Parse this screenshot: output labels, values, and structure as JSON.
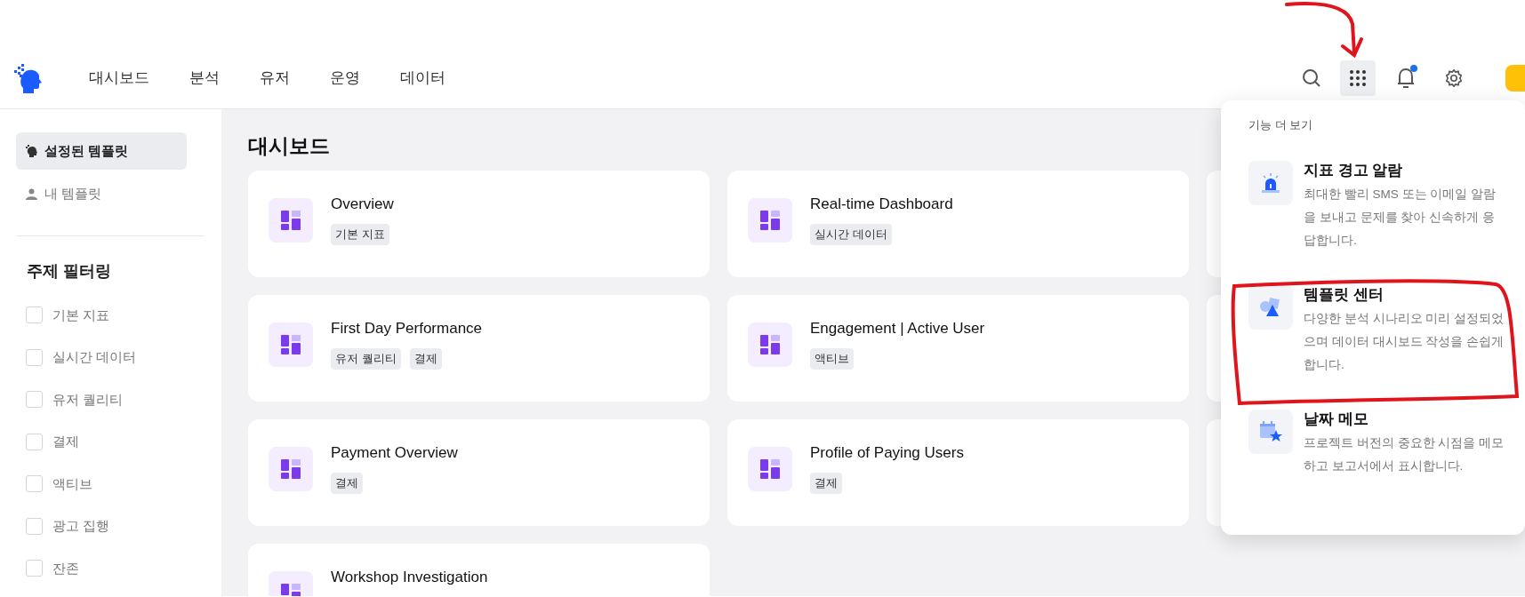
{
  "nav": {
    "items": [
      {
        "label": "대시보드"
      },
      {
        "label": "분석"
      },
      {
        "label": "유저"
      },
      {
        "label": "운영"
      },
      {
        "label": "데이터"
      }
    ],
    "apps_button": {
      "selected": true
    },
    "notifications": {
      "unread": true
    }
  },
  "sidebar": {
    "templates": [
      {
        "label": "설정된 템플릿",
        "kind": "preset",
        "selected": true
      },
      {
        "label": "내 템플릿",
        "kind": "mine",
        "selected": false
      }
    ],
    "filter_title": "주제 필터링",
    "filters": [
      {
        "label": "기본 지표",
        "checked": false
      },
      {
        "label": "실시간 데이터",
        "checked": false
      },
      {
        "label": "유저 퀄리티",
        "checked": false
      },
      {
        "label": "결제",
        "checked": false
      },
      {
        "label": "액티브",
        "checked": false
      },
      {
        "label": "광고 집행",
        "checked": false
      },
      {
        "label": "잔존",
        "checked": false
      }
    ]
  },
  "main": {
    "title": "대시보드",
    "cards": [
      {
        "title": "Overview",
        "tags": [
          "기본 지표"
        ]
      },
      {
        "title": "Real-time Dashboard",
        "tags": [
          "실시간 데이터"
        ]
      },
      {
        "title": "First Day Performance",
        "tags": [
          "유저 퀄리티",
          "결제"
        ]
      },
      {
        "title": "Engagement | Active User",
        "tags": [
          "액티브"
        ]
      },
      {
        "title": "Payment Overview",
        "tags": [
          "결제"
        ]
      },
      {
        "title": "Profile of Paying Users",
        "tags": [
          "결제"
        ]
      },
      {
        "title": "Workshop Investigation"
      }
    ]
  },
  "dropdown": {
    "title": "기능 더 보기",
    "items": [
      {
        "kind": "alarm",
        "title": "지표 경고 알람",
        "description": "최대한 빨리 SMS 또는 이메일 알람을 보내고 문제를 찾아 신속하게 응답합니다."
      },
      {
        "kind": "template",
        "title": "템플릿 센터",
        "description": "다양한 분석 시나리오 미리 설정되었으며 데이터 대시보드 작성을 손쉽게 합니다."
      },
      {
        "kind": "calendar",
        "title": "날짜 메모",
        "description": "프로젝트 버전의 중요한 시점을 메모하고 보고서에서 표시합니다."
      }
    ]
  }
}
